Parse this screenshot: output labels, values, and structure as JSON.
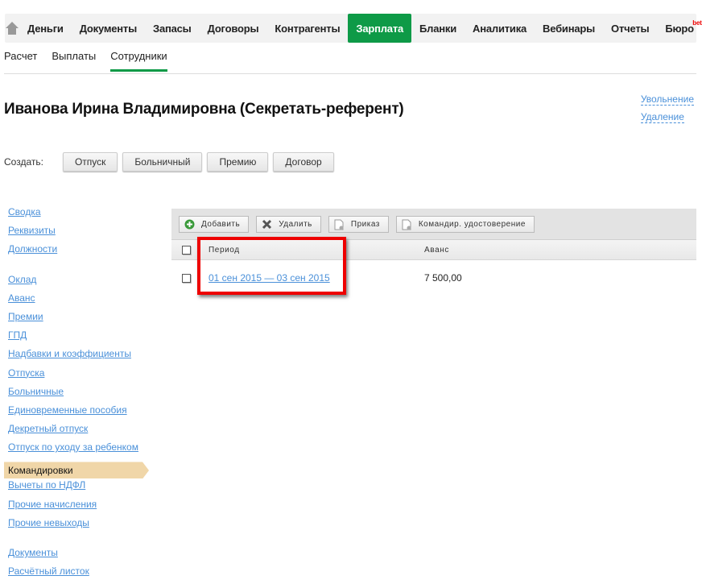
{
  "topnav": {
    "items": [
      "Деньги",
      "Документы",
      "Запасы",
      "Договоры",
      "Контрагенты",
      "Зарплата",
      "Бланки",
      "Аналитика",
      "Вебинары",
      "Отчеты",
      "Бюро"
    ],
    "beta": "beta"
  },
  "subnav": [
    "Расчет",
    "Выплаты",
    "Сотрудники"
  ],
  "title": "Иванова Ирина Владимировна (Секретать-референт)",
  "actions": {
    "dismiss": "Увольнение",
    "delete": "Удаление"
  },
  "create": {
    "label": "Создать:",
    "buttons": [
      "Отпуск",
      "Больничный",
      "Премию",
      "Договор"
    ]
  },
  "sidebar": {
    "group1": [
      "Сводка",
      "Реквизиты",
      "Должности"
    ],
    "group2": [
      "Оклад",
      "Аванс",
      "Премии",
      "ГПД",
      "Надбавки и коэффициенты",
      "Отпуска",
      "Больничные",
      "Единовременные пособия",
      "Декретный отпуск",
      "Отпуск по уходу за ребенком",
      "Командировки",
      "Вычеты по НДФЛ",
      "Прочие начисления",
      "Прочие невыходы"
    ],
    "group3": [
      "Документы",
      "Расчётный листок"
    ]
  },
  "toolbar": {
    "add": "Добавить",
    "delete": "Удалить",
    "order": "Приказ",
    "certificate": "Командир. удостоверение"
  },
  "table": {
    "headers": [
      "Период",
      "Аванс"
    ],
    "rows": [
      {
        "period": "01 сен 2015 — 03 сен 2015",
        "advance": "7 500,00"
      }
    ]
  },
  "colors": {
    "accent": "#0e9a47",
    "link": "#4a90d9",
    "active_side": "#f0d6a8",
    "highlight": "#e00000"
  }
}
